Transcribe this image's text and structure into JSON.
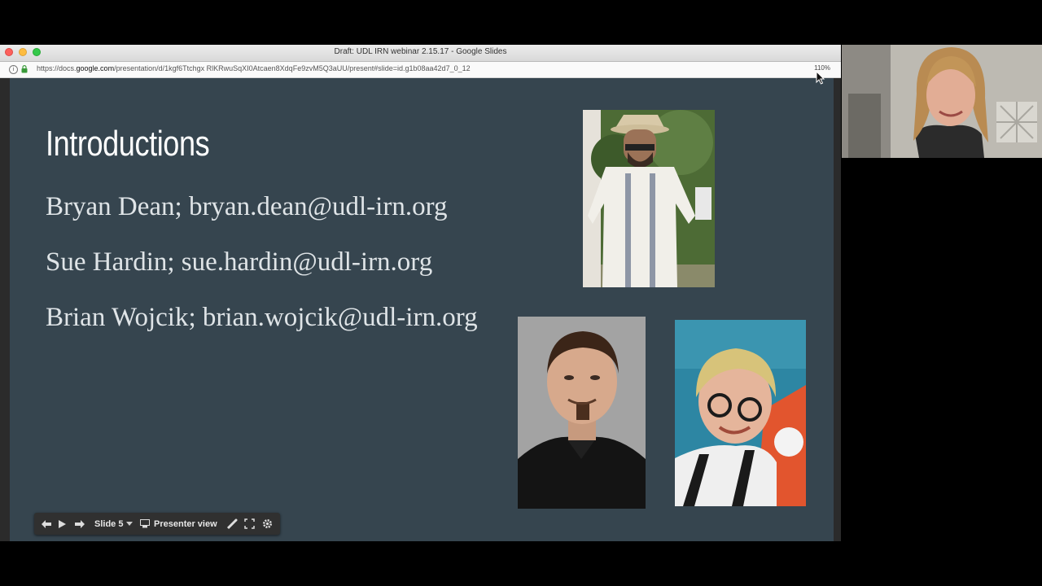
{
  "browser": {
    "window_title": "Draft: UDL IRN webinar 2.15.17 - Google Slides",
    "url_host": "https://docs.",
    "url_domain": "google.com",
    "url_path": "/presentation/d/1kgf6Ttchgx RlKRwuSqXI0Atcaen8XdqFe9zvM5Q3aUU/present#slide=id.g1b08aa42d7_0_12",
    "zoom": "110%"
  },
  "slide": {
    "title": "Introductions",
    "lines": [
      "Bryan Dean; bryan.dean@udl-irn.org",
      "Sue Hardin; sue.hardin@udl-irn.org",
      "Brian Wojcik; brian.wojcik@udl-irn.org"
    ],
    "background": "#36454f"
  },
  "toolbar": {
    "slide_label": "Slide 5",
    "presenter_view_label": "Presenter view"
  },
  "icons": [
    "info-icon",
    "lock-icon",
    "prev-icon",
    "play-icon",
    "next-icon",
    "chevron-down-icon",
    "presenter-icon",
    "laser-pointer-icon",
    "fullscreen-icon",
    "gear-icon",
    "cursor-icon"
  ]
}
